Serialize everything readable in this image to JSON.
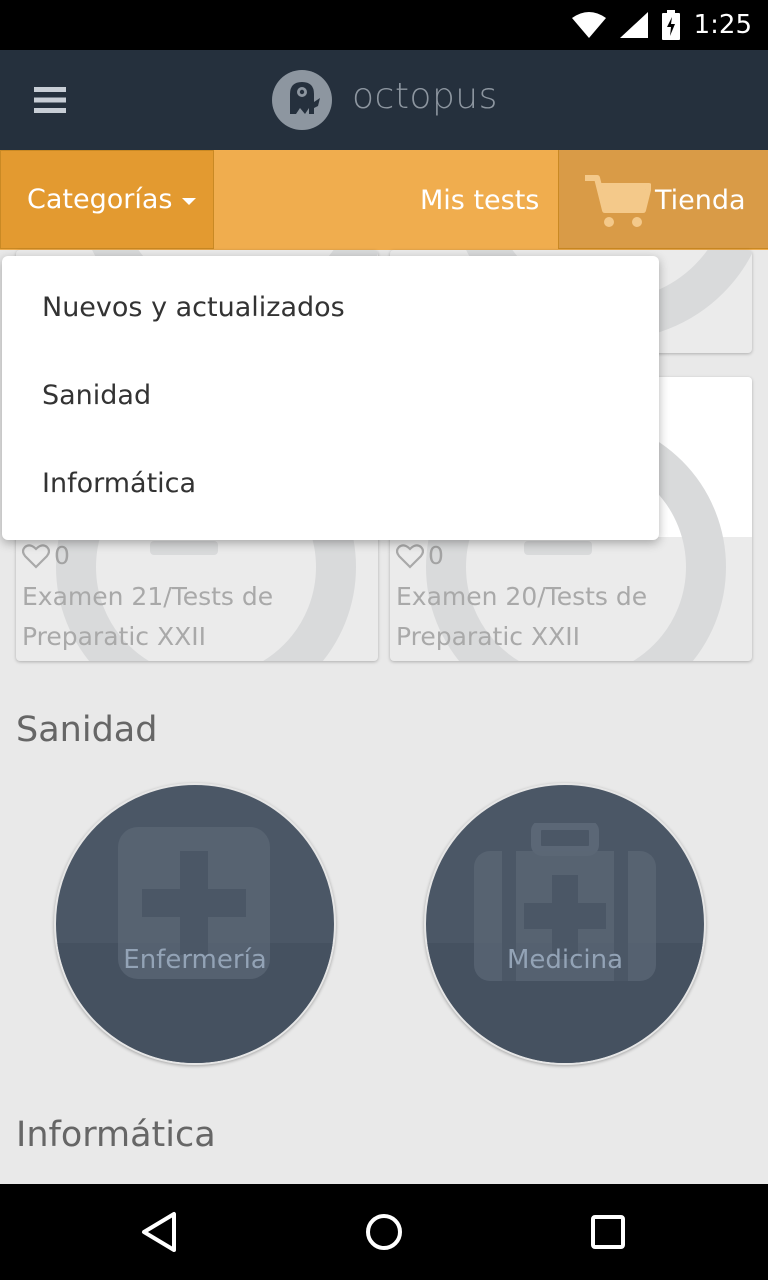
{
  "status_bar": {
    "time": "1:25"
  },
  "app_bar": {
    "title": "octopus"
  },
  "nav": {
    "categorias_label": "Categorías",
    "mis_tests_label": "Mis tests",
    "tienda_label": "Tienda"
  },
  "dropdown": {
    "items": [
      {
        "label": "Nuevos y actualizados"
      },
      {
        "label": "Sanidad"
      },
      {
        "label": "Informática"
      }
    ]
  },
  "tests": [
    {
      "likes": "0",
      "title_line1": "Examen 21/Tests de",
      "title_line2": "Preparatic XXII"
    },
    {
      "likes": "0",
      "title_line1": "Examen 20/Tests de",
      "title_line2": "Preparatic XXII"
    }
  ],
  "sections": {
    "sanidad": {
      "title": "Sanidad",
      "categories": [
        {
          "label": "Enfermería",
          "icon": "medical-cross-icon"
        },
        {
          "label": "Medicina",
          "icon": "first-aid-kit-icon"
        }
      ]
    },
    "informatica": {
      "title": "Informática"
    }
  },
  "colors": {
    "app_bar": "#25303d",
    "nav_bar": "#f0ad4e",
    "nav_active": "#e39a30",
    "circle": "#4b5766"
  }
}
